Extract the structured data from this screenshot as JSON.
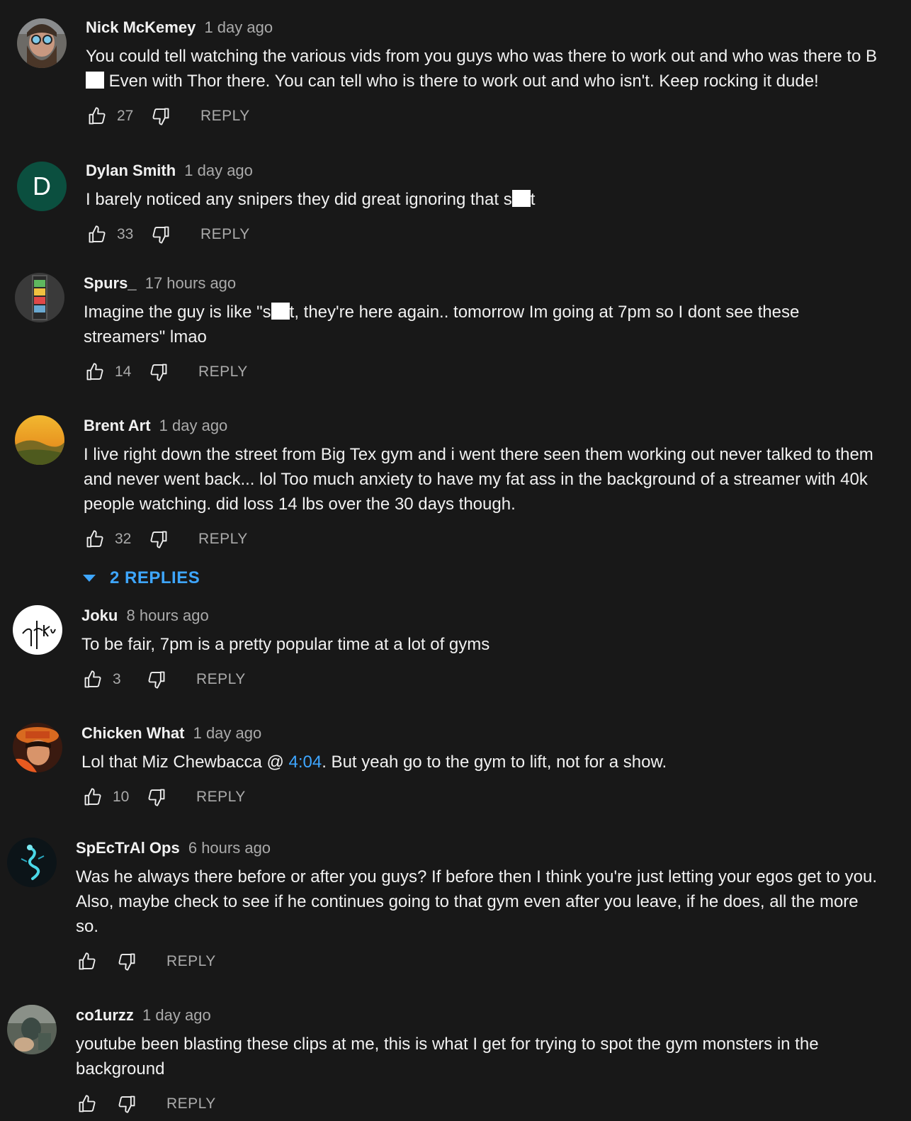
{
  "reply_label": "REPLY",
  "comments": [
    {
      "author": "Nick McKemey",
      "time": "1 day ago",
      "text_parts": [
        "You could tell watching the various vids from you guys who was there to work out and who was there to B",
        " Even with Thor there. You can tell who is there to work out and who isn't. Keep rocking it dude!"
      ],
      "likes": "27",
      "avatar_icon": "bearded-man-avatar"
    },
    {
      "author": "Dylan Smith",
      "time": "1 day ago",
      "text_parts": [
        "I barely noticed any snipers they did great ignoring that s",
        "t"
      ],
      "likes": "33",
      "avatar_letter": "D",
      "avatar_color": "#0b4f3f"
    },
    {
      "author": "Spurs_",
      "time": "17 hours ago",
      "text_parts": [
        "Imagine the guy is like \"s",
        "t, they're here again.. tomorrow Im going at 7pm so I dont see these streamers\" lmao"
      ],
      "likes": "14",
      "avatar_icon": "striped-bar-avatar"
    },
    {
      "author": "Brent Art",
      "time": "1 day ago",
      "text": "I live right down the street from Big Tex gym and i went there seen them working out never talked to them and never went back... lol Too much anxiety to have my fat ass in the background of a streamer with 40k people watching. did loss 14 lbs over the 30 days though.",
      "likes": "32",
      "avatar_icon": "sunset-landscape-avatar",
      "replies_toggle": "2 REPLIES"
    },
    {
      "author": "Joku",
      "time": "8 hours ago",
      "text": "To be fair, 7pm is a pretty popular time at a lot of gyms",
      "likes": "3",
      "avatar_icon": "signature-avatar"
    },
    {
      "author": "Chicken What",
      "time": "1 day ago",
      "text_before": "Lol that Miz Chewbacca @ ",
      "timestamp_link": "4:04",
      "text_after": ". But yeah go to the gym to lift, not for a show.",
      "likes": "10",
      "avatar_icon": "anime-character-avatar"
    },
    {
      "author": "SpEcTrAl Ops",
      "time": "6 hours ago",
      "text": "Was he always there before or after you guys? If before then I think you're just letting your egos get to you. Also, maybe check to see if he continues going to that gym even after you leave, if he does, all the more so.",
      "likes": "",
      "avatar_icon": "dragon-avatar"
    },
    {
      "author": "co1urzz",
      "time": "1 day ago",
      "text": "youtube been blasting these clips at me, this is what I get for trying to spot the gym monsters in the background",
      "likes": "",
      "avatar_icon": "figure-avatar"
    }
  ],
  "colors": {
    "background": "#181818",
    "text": "#f1f1f1",
    "secondary": "#aaaaaa",
    "link": "#3ea6ff"
  }
}
